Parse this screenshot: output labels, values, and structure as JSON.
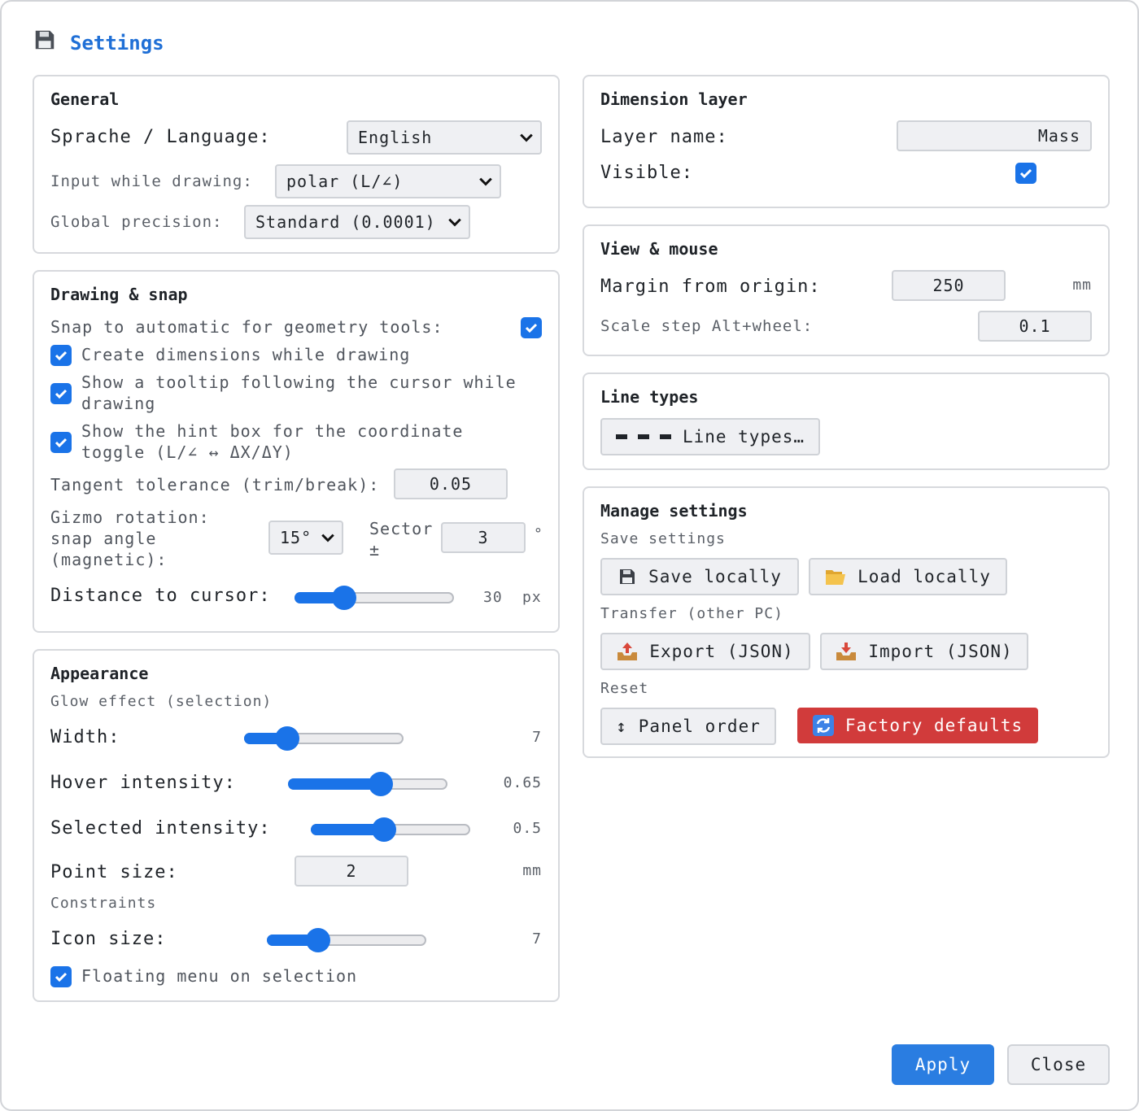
{
  "header": {
    "icon": "floppy-disk-icon",
    "title": "Settings"
  },
  "general": {
    "heading": "General",
    "language_label": "Sprache / Language:",
    "language_value": "English",
    "input_label": "Input while drawing:",
    "input_value": "polar (L/∠)",
    "precision_label": "Global precision:",
    "precision_value": "Standard (0.0001)"
  },
  "drawing": {
    "heading": "Drawing & snap",
    "snap_label": "Snap to automatic for geometry tools:",
    "snap_checked": true,
    "create_dims_label": "Create dimensions while drawing",
    "tooltip_label_1": "Show a tooltip following the cursor while",
    "tooltip_label_2": "drawing",
    "hint_label_1": "Show the hint box for the coordinate",
    "hint_label_2": "toggle (L/∠ ↔ ΔX/ΔY)",
    "tangent_label": "Tangent tolerance (trim/break):",
    "tangent_value": "0.05",
    "gizmo_label_1": "Gizmo rotation:",
    "gizmo_label_2": "snap angle",
    "gizmo_label_3": "(magnetic):",
    "gizmo_value": "15°",
    "sector_label_1": "Sector",
    "sector_label_2": "±",
    "sector_value": "3",
    "sector_unit": "°",
    "distance_label": "Distance to cursor:",
    "distance_value": "30",
    "distance_unit": "px",
    "distance_fraction": 0.31
  },
  "appearance": {
    "heading": "Appearance",
    "glow_label": "Glow effect (selection)",
    "width_label": "Width:",
    "width_value": "7",
    "width_fraction": 0.27,
    "hover_label": "Hover intensity:",
    "hover_value": "0.65",
    "hover_fraction": 0.58,
    "selected_label": "Selected intensity:",
    "selected_value": "0.5",
    "selected_fraction": 0.46,
    "point_label": "Point size:",
    "point_value": "2",
    "point_unit": "mm",
    "constraints_label": "Constraints",
    "icon_label": "Icon size:",
    "icon_value": "7",
    "icon_fraction": 0.32,
    "floating_label": "Floating menu on selection"
  },
  "dimension_layer": {
    "heading": "Dimension layer",
    "layer_label": "Layer name:",
    "layer_value": "Mass",
    "visible_label": "Visible:"
  },
  "view": {
    "heading": "View & mouse",
    "margin_label": "Margin from origin:",
    "margin_value": "250",
    "margin_unit": "mm",
    "scale_label": "Scale step Alt+wheel:",
    "scale_value": "0.1"
  },
  "line_types": {
    "heading": "Line types",
    "button_label": "Line types…"
  },
  "manage": {
    "heading": "Manage settings",
    "save_label": "Save settings",
    "save_locally": "Save locally",
    "load_locally": "Load locally",
    "transfer_label": "Transfer (other PC)",
    "export": "Export (JSON)",
    "import": "Import (JSON)",
    "reset_label": "Reset",
    "panel_order": "Panel order",
    "panel_order_glyph": "↕",
    "factory": "Factory defaults"
  },
  "footer": {
    "apply": "Apply",
    "close": "Close"
  },
  "colors": {
    "accent": "#1a73e8",
    "title": "#1f6fd6",
    "danger": "#d13b3b"
  }
}
